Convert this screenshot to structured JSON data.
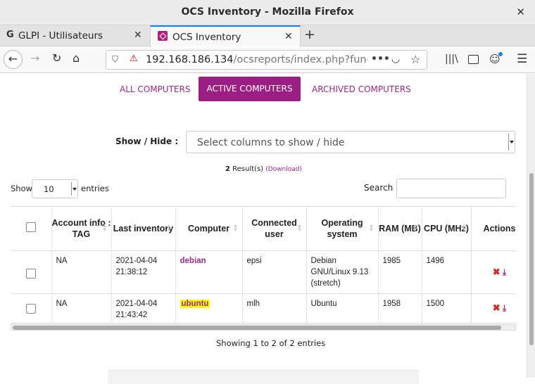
{
  "window": {
    "title": "OCS Inventory - Mozilla Firefox",
    "close_glyph": "✕"
  },
  "tabs": [
    {
      "label": "GLPI - Utilisateurs",
      "icon": "glpi-icon",
      "icon_glyph": "G"
    },
    {
      "label": "OCS Inventory",
      "icon": "ocs-icon"
    }
  ],
  "tab_close_glyph": "✕",
  "newtab_glyph": "+",
  "nav": {
    "back_glyph": "←",
    "forward_glyph": "→",
    "reload_glyph": "↻",
    "home_glyph": "⌂",
    "url_host": "192.168.186.134",
    "url_path": "/ocsreports/index.php?function",
    "more_glyph": "•••",
    "pocket_glyph": "◡",
    "star_glyph": "☆",
    "library_glyph": "|||\\",
    "account_glyph": "☺",
    "menu_glyph": "☰",
    "shield_glyph": "⛉",
    "lock_glyph": "⚠"
  },
  "subtabs": [
    "ALL COMPUTERS",
    "ACTIVE COMPUTERS",
    "ARCHIVED COMPUTERS"
  ],
  "showhide": {
    "label": "Show / Hide :",
    "placeholder": "Select columns to show / hide"
  },
  "results": {
    "count": "2",
    "text": " Result(s) ",
    "download": "(Download)"
  },
  "length": {
    "show": "Show",
    "value": "10",
    "entries": "entries"
  },
  "search": {
    "label": "Search :",
    "value": ""
  },
  "table": {
    "headers": [
      "Account info : TAG",
      "Last inventory",
      "Computer",
      "Connected user",
      "Operating system",
      "RAM (MB)",
      "CPU (MHz)",
      "Actions"
    ],
    "rows": [
      {
        "tag": "NA",
        "last_inventory": "2021-04-04 21:38:12",
        "computer": "debian",
        "user": "epsi",
        "os": "Debian GNU/Linux 9.13 (stretch)",
        "ram": "1985",
        "cpu": "1496"
      },
      {
        "tag": "NA",
        "last_inventory": "2021-04-04 21:43:42",
        "computer": "ubuntu",
        "user": "mlh",
        "os": "Ubuntu",
        "ram": "1958",
        "cpu": "1500"
      }
    ],
    "delete_glyph": "✖",
    "download_glyph": "⤓"
  },
  "footer": {
    "info": "Showing 1 to 2 of 2 entries"
  }
}
